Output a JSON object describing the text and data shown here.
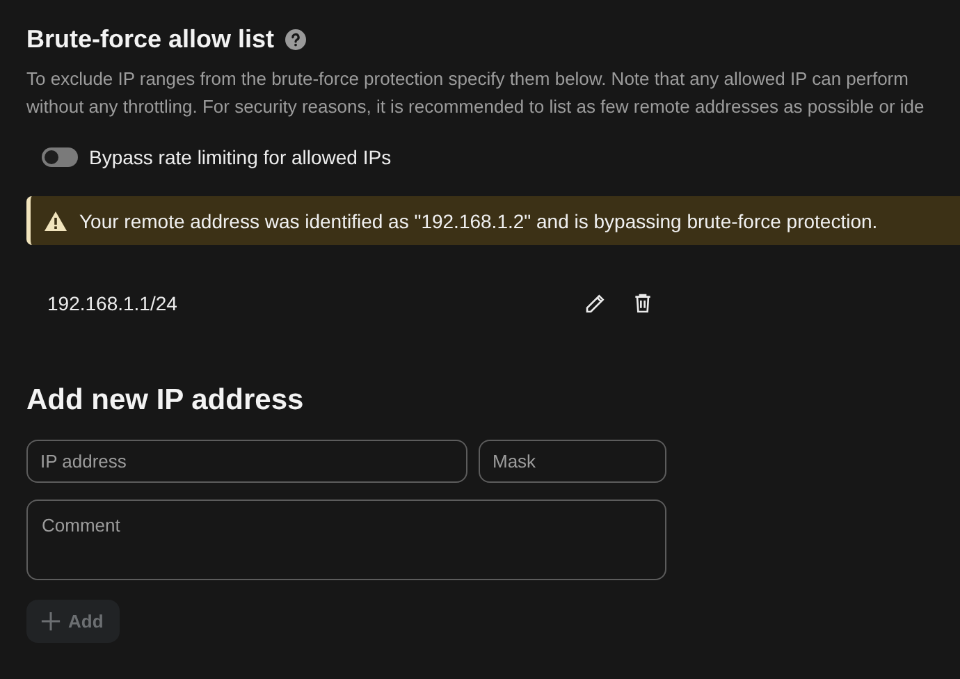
{
  "section": {
    "title": "Brute-force allow list",
    "description_lines": [
      "To exclude IP ranges from the brute-force protection specify them below. Note that any allowed IP can perform",
      "without any throttling. For security reasons, it is recommended to list as few remote addresses as possible or ide"
    ]
  },
  "bypass_toggle": {
    "label": "Bypass rate limiting for allowed IPs",
    "on": false
  },
  "warning": {
    "text": "Your remote address was identified as \"192.168.1.2\" and is bypassing brute-force protection."
  },
  "allow_list": [
    {
      "address": "192.168.1.1/24"
    }
  ],
  "add_form": {
    "title": "Add new IP address",
    "ip_field": {
      "placeholder": "IP address"
    },
    "mask_field": {
      "placeholder": "Mask"
    },
    "comment_field": {
      "placeholder": "Comment"
    },
    "add_button": {
      "label": "Add",
      "disabled": true
    }
  }
}
